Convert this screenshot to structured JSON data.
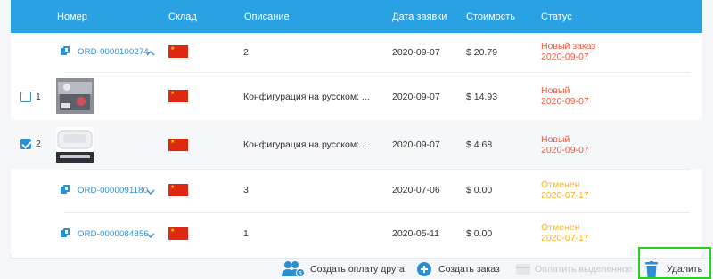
{
  "header": {
    "col_number": "Номер",
    "col_warehouse": "Склад",
    "col_description": "Описание",
    "col_date": "Дата заявки",
    "col_cost": "Стоимость",
    "col_status": "Статус"
  },
  "rows": [
    {
      "order": "ORD-0000100274",
      "description": "2",
      "date": "2020-09-07",
      "cost": "$ 20.79",
      "status": "Новый заказ",
      "status_date": "2020-09-07",
      "expanded": true
    },
    {
      "index": "1",
      "checked": false,
      "description": "Конфигурация на русском: ...",
      "date": "2020-09-07",
      "cost": "$ 14.93",
      "status": "Новый",
      "status_date": "2020-09-07"
    },
    {
      "index": "2",
      "checked": true,
      "description": "Конфигурация на русском: ...",
      "date": "2020-09-07",
      "cost": "$ 4.68",
      "status": "Новый",
      "status_date": "2020-09-07"
    },
    {
      "order": "ORD-0000091180",
      "description": "3",
      "date": "2020-07-06",
      "cost": "$ 0.00",
      "status": "Отменен",
      "status_date": "2020-07-17",
      "expanded": false
    },
    {
      "order": "ORD-0000084856",
      "description": "1",
      "date": "2020-05-11",
      "cost": "$ 0.00",
      "status": "Отменен",
      "status_date": "2020-07-17",
      "expanded": false
    }
  ],
  "colors": {
    "header_bg": "#2aa1e3",
    "link": "#2b8fd6",
    "status_new": "#f05a3c",
    "status_cancelled": "#f4b422",
    "highlight": "#27d21e"
  },
  "footer": {
    "create_friend_payment": "Создать оплату друга",
    "create_order": "Создать заказ",
    "pay_selected": "Оплатить выделенное",
    "delete": "Удалить"
  },
  "icons": {
    "order": "document-copy-icon",
    "warehouse": "china-flag-icon",
    "friend_payment": "users-dollar-icon",
    "create_order": "plus-circle-icon",
    "pay_selected": "card-icon",
    "delete": "trash-icon"
  }
}
